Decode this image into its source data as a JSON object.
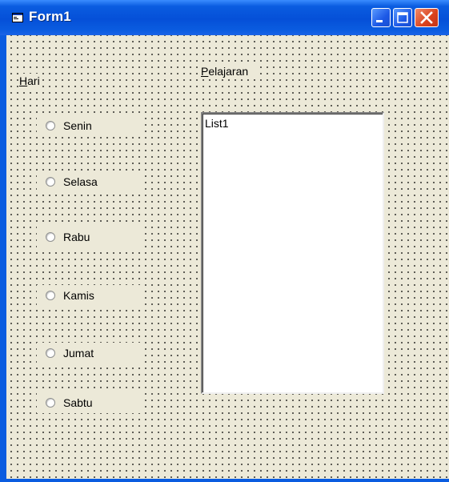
{
  "window": {
    "title": "Form1"
  },
  "labels": {
    "hari": {
      "hotkey": "H",
      "rest": "ari"
    },
    "pelajaran": {
      "hotkey": "P",
      "rest": "elajaran"
    }
  },
  "radios": [
    {
      "label": "Senin",
      "checked": false
    },
    {
      "label": "Selasa",
      "checked": false
    },
    {
      "label": "Rabu",
      "checked": false
    },
    {
      "label": "Kamis",
      "checked": false
    },
    {
      "label": "Jumat",
      "checked": false
    },
    {
      "label": "Sabtu",
      "checked": false
    }
  ],
  "listbox": {
    "items": [
      "List1"
    ]
  },
  "colors": {
    "titlebar": "#0a5ce0",
    "form_background": "#ece9d8",
    "close_button": "#d9421c"
  },
  "icons": [
    "form-icon",
    "minimize-icon",
    "maximize-icon",
    "close-icon"
  ]
}
